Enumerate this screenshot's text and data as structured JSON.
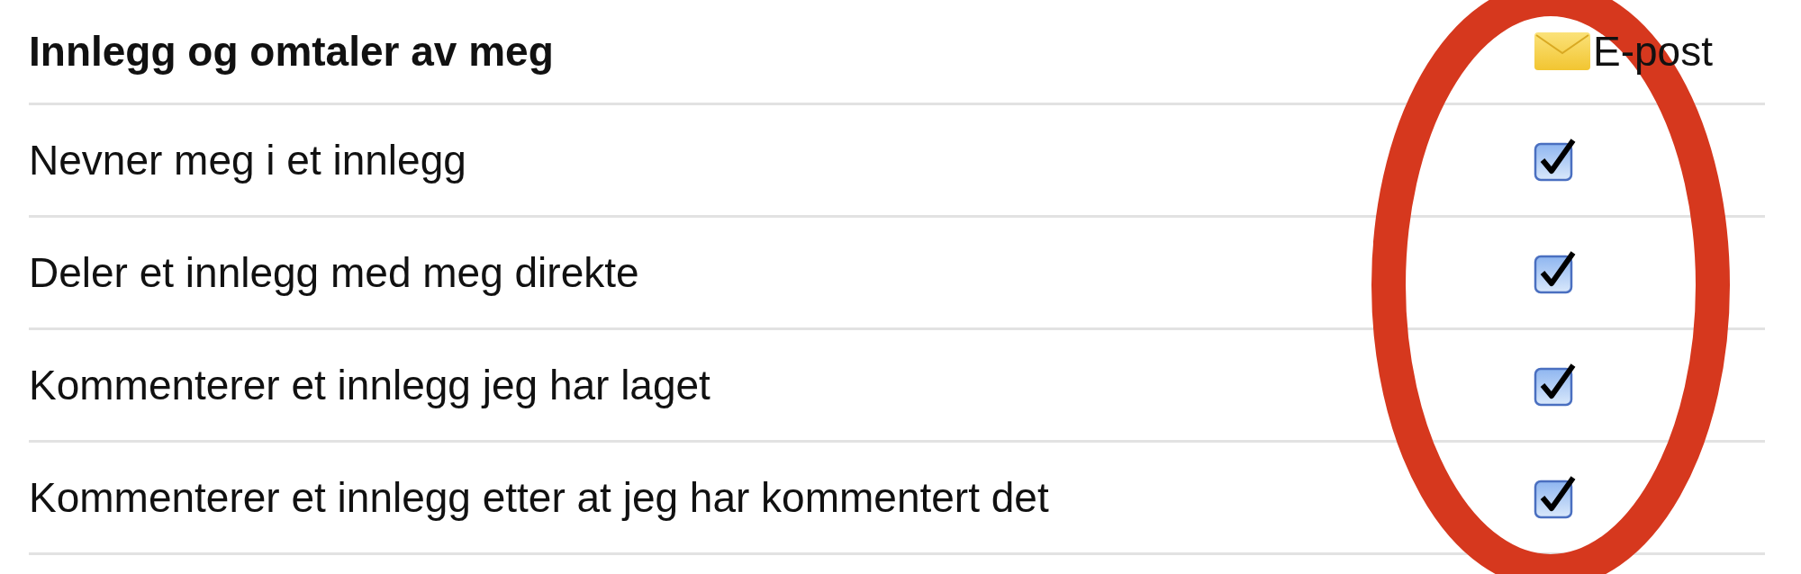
{
  "table": {
    "heading": "Innlegg og omtaler av meg",
    "email_column": "E-post",
    "rows": [
      {
        "label": "Nevner meg i et innlegg",
        "checked": true
      },
      {
        "label": "Deler et innlegg med meg direkte",
        "checked": true
      },
      {
        "label": "Kommenterer et innlegg jeg har laget",
        "checked": true
      },
      {
        "label": "Kommenterer et innlegg etter at jeg har kommentert det",
        "checked": true
      }
    ]
  }
}
